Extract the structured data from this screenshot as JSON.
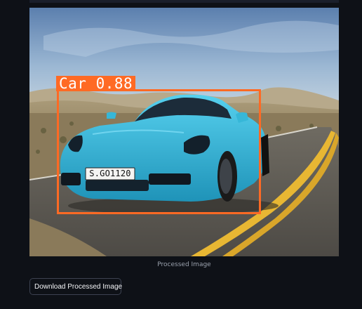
{
  "detection": {
    "label": "Car 0.88",
    "class": "Car",
    "confidence": 0.88,
    "color": "#ff6a24"
  },
  "license_plate": "S.GO1120",
  "caption": "Processed Image",
  "download_button": {
    "label": "Download Processed Image"
  },
  "colors": {
    "background": "#0e1117",
    "car": "#36b7d8",
    "bbox": "#ff6a24"
  }
}
